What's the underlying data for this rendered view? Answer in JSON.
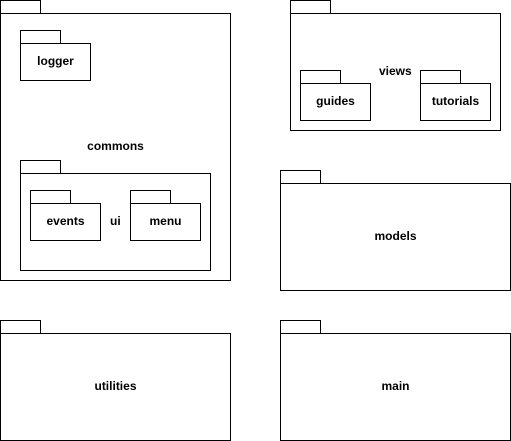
{
  "packages": {
    "commons": {
      "label": "commons",
      "logger": {
        "label": "logger"
      },
      "ui": {
        "label": "ui",
        "events": {
          "label": "events"
        },
        "menu": {
          "label": "menu"
        }
      }
    },
    "views": {
      "label": "views",
      "guides": {
        "label": "guides"
      },
      "tutorials": {
        "label": "tutorials"
      }
    },
    "models": {
      "label": "models"
    },
    "utilities": {
      "label": "utilities"
    },
    "main": {
      "label": "main"
    }
  },
  "colors": {
    "stroke": "#000000",
    "fill": "#ffffff"
  }
}
